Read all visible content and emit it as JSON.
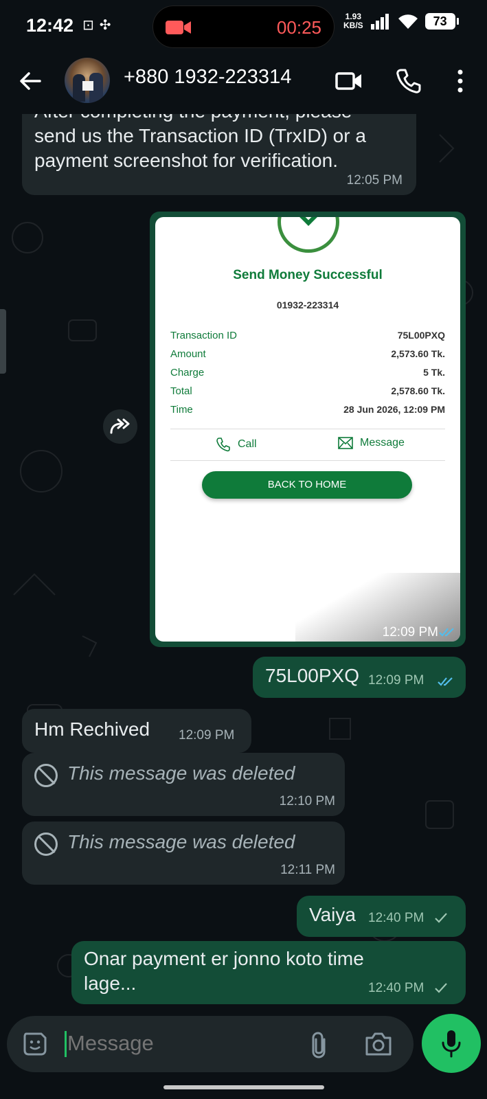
{
  "status_bar": {
    "time": "12:42",
    "recording_time": "00:25",
    "net_speed_value": "1.93",
    "net_speed_unit": "KB/S",
    "battery": "73"
  },
  "header": {
    "contact": "+880 1932-223314"
  },
  "messages": [
    {
      "dir": "in",
      "text_top": "After completing the payment, please",
      "text": "send us the Transaction ID (TrxID) or a payment screenshot for verification.",
      "time": "12:05 PM"
    },
    {
      "dir": "out",
      "type": "image",
      "time": "12:09 PM"
    },
    {
      "dir": "out",
      "text": "75L00PXQ",
      "time": "12:09 PM"
    },
    {
      "dir": "in",
      "text": "Hm Rechived",
      "time": "12:09 PM"
    },
    {
      "dir": "in",
      "deleted": "This message was deleted",
      "time": "12:10 PM"
    },
    {
      "dir": "in",
      "deleted": "This message was deleted",
      "time": "12:11 PM"
    },
    {
      "dir": "out",
      "text": "Vaiya",
      "time": "12:40 PM"
    },
    {
      "dir": "out",
      "text": "Onar payment er jonno koto time lage...",
      "time": "12:40 PM"
    }
  ],
  "receipt": {
    "title": "Send Money Successful",
    "number": "01932-223314",
    "rows": [
      {
        "label": "Transaction ID",
        "value": "75L00PXQ"
      },
      {
        "label": "Amount",
        "value": "2,573.60 Tk."
      },
      {
        "label": "Charge",
        "value": "5 Tk."
      },
      {
        "label": "Total",
        "value": "2,578.60 Tk."
      },
      {
        "label": "Time",
        "value": "28 Jun 2026, 12:09 PM"
      }
    ],
    "call_label": "Call",
    "message_label": "Message",
    "button": "BACK TO HOME"
  },
  "input": {
    "placeholder": "Message"
  },
  "colors": {
    "outgoing": "#134d37",
    "incoming": "#1f272a",
    "accent": "#21c063",
    "receipt_green": "#0f7b3a"
  }
}
